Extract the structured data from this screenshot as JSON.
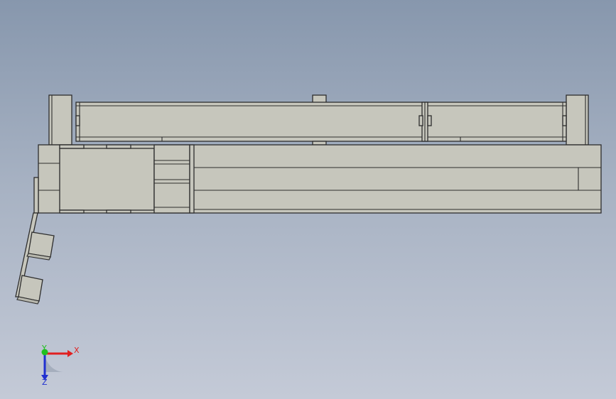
{
  "viewport": {
    "background_top": "#8797ad",
    "background_bottom": "#c4cad7",
    "part_color": "#c6c6bc",
    "edge_color": "#2d2d2d"
  },
  "triad": {
    "x_label": "X",
    "y_label": "Y",
    "z_label": "Z",
    "x_color": "#e02020",
    "y_color": "#20c020",
    "z_color": "#2030d0"
  }
}
